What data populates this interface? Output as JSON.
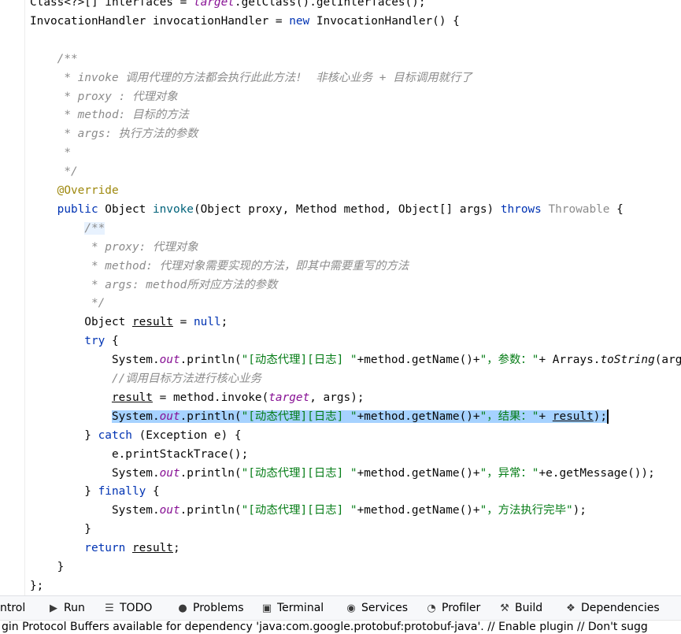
{
  "code": {
    "lines": [
      [
        [
          "plain",
          "Class<?>[] interfaces = "
        ],
        [
          "fld",
          "target"
        ],
        [
          "plain",
          ".getClass().getInterfaces();"
        ]
      ],
      [
        [
          "plain",
          "InvocationHandler invocationHandler = "
        ],
        [
          "kw",
          "new"
        ],
        [
          "plain",
          " InvocationHandler() {"
        ]
      ],
      [],
      [
        [
          "doc",
          "    /**"
        ]
      ],
      [
        [
          "doc",
          "     * invoke 调用代理的方法都会执行此此方法!  非核心业务 + 目标调用就行了"
        ]
      ],
      [
        [
          "doc",
          "     * proxy : 代理对象"
        ]
      ],
      [
        [
          "doc",
          "     * method: 目标的方法"
        ]
      ],
      [
        [
          "doc",
          "     * args: 执行方法的参数"
        ]
      ],
      [
        [
          "doc",
          "     *"
        ]
      ],
      [
        [
          "doc",
          "     */"
        ]
      ],
      [
        [
          "ann",
          "    @Override"
        ]
      ],
      [
        [
          "kw",
          "    public"
        ],
        [
          "plain",
          " Object "
        ],
        [
          "fn",
          "invoke"
        ],
        [
          "plain",
          "(Object proxy, Method method, Object[] args) "
        ],
        [
          "kw",
          "throws"
        ],
        [
          "plain",
          " "
        ],
        [
          "gray",
          "Throwable"
        ],
        [
          "plain",
          " {"
        ]
      ],
      [
        [
          "plain",
          "        "
        ],
        [
          "docsel",
          "/**"
        ]
      ],
      [
        [
          "doc",
          "         * proxy: 代理对象"
        ]
      ],
      [
        [
          "doc",
          "         * method: 代理对象需要实现的方法，即其中需要重写的方法"
        ]
      ],
      [
        [
          "doc",
          "         * args: method所对应方法的参数"
        ]
      ],
      [
        [
          "doc",
          "         */"
        ]
      ],
      [
        [
          "plain",
          "        Object "
        ],
        [
          "ul",
          "result"
        ],
        [
          "plain",
          " = "
        ],
        [
          "kw",
          "null"
        ],
        [
          "plain",
          ";"
        ]
      ],
      [
        [
          "kw",
          "        try"
        ],
        [
          "plain",
          " {"
        ]
      ],
      [
        [
          "plain",
          "            System."
        ],
        [
          "fld",
          "out"
        ],
        [
          "plain",
          ".println("
        ],
        [
          "str",
          "\"[动态代理][日志] \""
        ],
        [
          "plain",
          "+method.getName()+"
        ],
        [
          "str",
          "\"，参数：\""
        ],
        [
          "plain",
          "+ Arrays."
        ],
        [
          "static",
          "toString"
        ],
        [
          "plain",
          "(args));"
        ]
      ],
      [
        [
          "cmt",
          "            //调用目标方法进行核心业务"
        ]
      ],
      [
        [
          "plain",
          "            "
        ],
        [
          "ul",
          "result"
        ],
        [
          "plain",
          " = method.invoke("
        ],
        [
          "fld",
          "target"
        ],
        [
          "plain",
          ", args);"
        ]
      ],
      [
        [
          "plain",
          "            "
        ],
        [
          "sel",
          "System."
        ],
        [
          "selfld",
          "out"
        ],
        [
          "sel",
          ".println("
        ],
        [
          "selstr",
          "\"[动态代理][日志] \""
        ],
        [
          "sel",
          "+method.getName()+"
        ],
        [
          "selstr",
          "\"，结果：\""
        ],
        [
          "sel",
          "+ "
        ],
        [
          "selul",
          "result"
        ],
        [
          "sel",
          ");"
        ],
        [
          "caret",
          ""
        ]
      ],
      [
        [
          "plain",
          "        } "
        ],
        [
          "kw",
          "catch"
        ],
        [
          "plain",
          " (Exception e) {"
        ]
      ],
      [
        [
          "plain",
          "            e.printStackTrace();"
        ]
      ],
      [
        [
          "plain",
          "            System."
        ],
        [
          "fld",
          "out"
        ],
        [
          "plain",
          ".println("
        ],
        [
          "str",
          "\"[动态代理][日志] \""
        ],
        [
          "plain",
          "+method.getName()+"
        ],
        [
          "str",
          "\"，异常：\""
        ],
        [
          "plain",
          "+e.getMessage());"
        ]
      ],
      [
        [
          "plain",
          "        } "
        ],
        [
          "kw",
          "finally"
        ],
        [
          "plain",
          " {"
        ]
      ],
      [
        [
          "plain",
          "            System."
        ],
        [
          "fld",
          "out"
        ],
        [
          "plain",
          ".println("
        ],
        [
          "str",
          "\"[动态代理][日志] \""
        ],
        [
          "plain",
          "+method.getName()+"
        ],
        [
          "str",
          "\"，方法执行完毕\""
        ],
        [
          "plain",
          ");"
        ]
      ],
      [
        [
          "plain",
          "        }"
        ]
      ],
      [
        [
          "kw",
          "        return"
        ],
        [
          "plain",
          " "
        ],
        [
          "ul",
          "result"
        ],
        [
          "plain",
          ";"
        ]
      ],
      [
        [
          "plain",
          "    }"
        ]
      ],
      [
        [
          "plain",
          "};"
        ]
      ]
    ]
  },
  "toolbar": {
    "items": [
      {
        "name": "control",
        "icon": "",
        "label": "ntrol"
      },
      {
        "name": "run",
        "icon": "▶",
        "label": "Run"
      },
      {
        "name": "todo",
        "icon": "☰",
        "label": "TODO"
      },
      {
        "name": "problems",
        "icon": "●",
        "label": "Problems"
      },
      {
        "name": "terminal",
        "icon": "▣",
        "label": "Terminal"
      },
      {
        "name": "services",
        "icon": "◉",
        "label": "Services"
      },
      {
        "name": "profiler",
        "icon": "◔",
        "label": "Profiler"
      },
      {
        "name": "build",
        "icon": "⚒",
        "label": "Build"
      },
      {
        "name": "dependencies",
        "icon": "❖",
        "label": "Dependencies"
      }
    ]
  },
  "status": {
    "message": "gin Protocol Buffers available for dependency 'java:com.google.protobuf:protobuf-java'. // Enable plugin // Don't sugg"
  }
}
